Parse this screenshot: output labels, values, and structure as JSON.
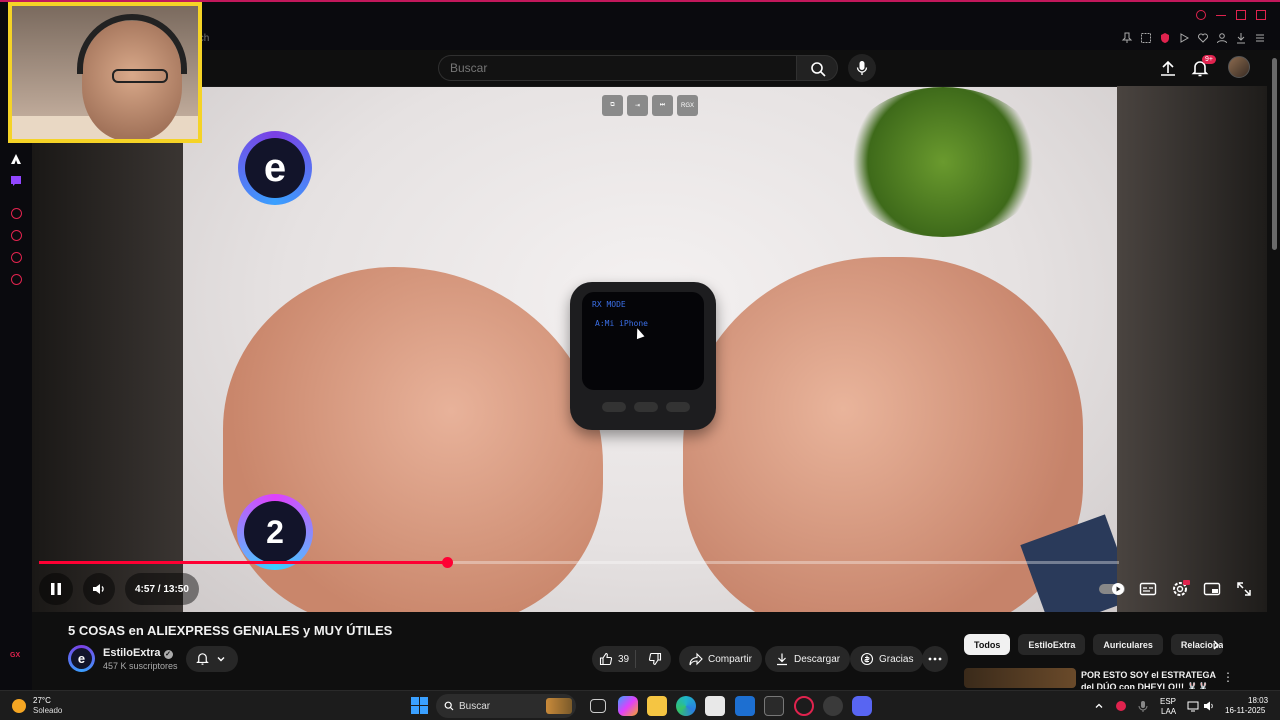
{
  "browser": {
    "tab_hint": "tch",
    "accent": "#e0234e"
  },
  "header": {
    "search_placeholder": "Buscar",
    "notifications_badge": "9+"
  },
  "video": {
    "overlay_number": "2",
    "overlay_logo": "e",
    "device_line1": "RX MODE",
    "device_line2": "A:Mi iPhone",
    "ext_label": "RGX",
    "time": "4:57 / 13:50",
    "progress_fraction": 0.378
  },
  "meta": {
    "title": "5 COSAS en ALIEXPRESS GENIALES y MUY ÚTILES",
    "channel": "EstiloExtra",
    "subscribers": "457 K suscriptores",
    "likes": "39",
    "share": "Compartir",
    "download": "Descargar",
    "thanks": "Gracias"
  },
  "chips": [
    "Todos",
    "EstiloExtra",
    "Auriculares",
    "Relaciona"
  ],
  "recommendation": {
    "title": "POR ESTO SOY el ESTRATEGA del DÚO con DHEYLO!!! 🐰🐰"
  },
  "taskbar": {
    "temp": "27°C",
    "weather": "Soleado",
    "search": "Buscar",
    "lang": "ESP",
    "region": "LAA",
    "time": "18:03",
    "date": "16-11-2025"
  },
  "sidebar_label": "GX",
  "colors": {
    "progress": "#ff0033",
    "cam_border": "#f5d326"
  }
}
